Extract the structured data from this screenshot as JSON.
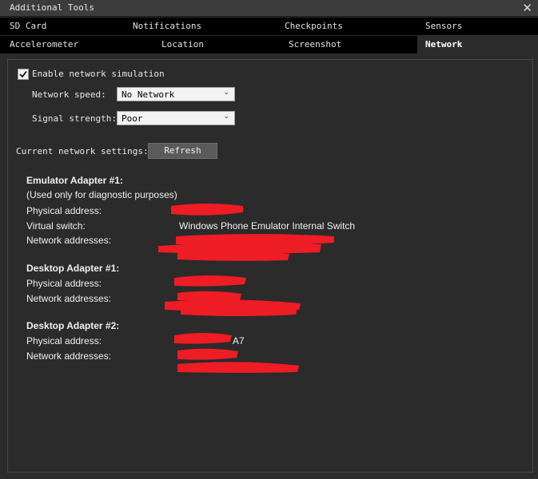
{
  "window": {
    "title": "Additional Tools",
    "close_glyph": "✕"
  },
  "tabs_row1": [
    "SD Card",
    "Notifications",
    "Checkpoints",
    "Sensors"
  ],
  "tabs_row2": [
    "Accelerometer",
    "Location",
    "Screenshot",
    "Network"
  ],
  "active_tab": "Network",
  "network": {
    "enable_label": "Enable network simulation",
    "enabled": true,
    "speed_label": "Network speed:",
    "speed_value": "No Network",
    "signal_label": "Signal strength:",
    "signal_value": "Poor",
    "current_label": "Current network settings:",
    "refresh_label": "Refresh"
  },
  "adapters": {
    "emu1": {
      "title": "Emulator Adapter #1:",
      "note": "(Used only for diagnostic purposes)",
      "physical_label": "Physical address:",
      "switch_label": "Virtual switch:",
      "switch_value": "Windows Phone Emulator Internal Switch",
      "addresses_label": "Network addresses:"
    },
    "desk1": {
      "title": "Desktop Adapter #1:",
      "physical_label": "Physical address:",
      "addresses_label": "Network addresses:"
    },
    "desk2": {
      "title": "Desktop Adapter #2:",
      "physical_label": "Physical address:",
      "physical_partial": "A7",
      "addresses_label": "Network addresses:"
    }
  },
  "colors": {
    "redaction": "#ee1c24",
    "background": "#2b2b2b",
    "tab_bar": "#000000"
  }
}
